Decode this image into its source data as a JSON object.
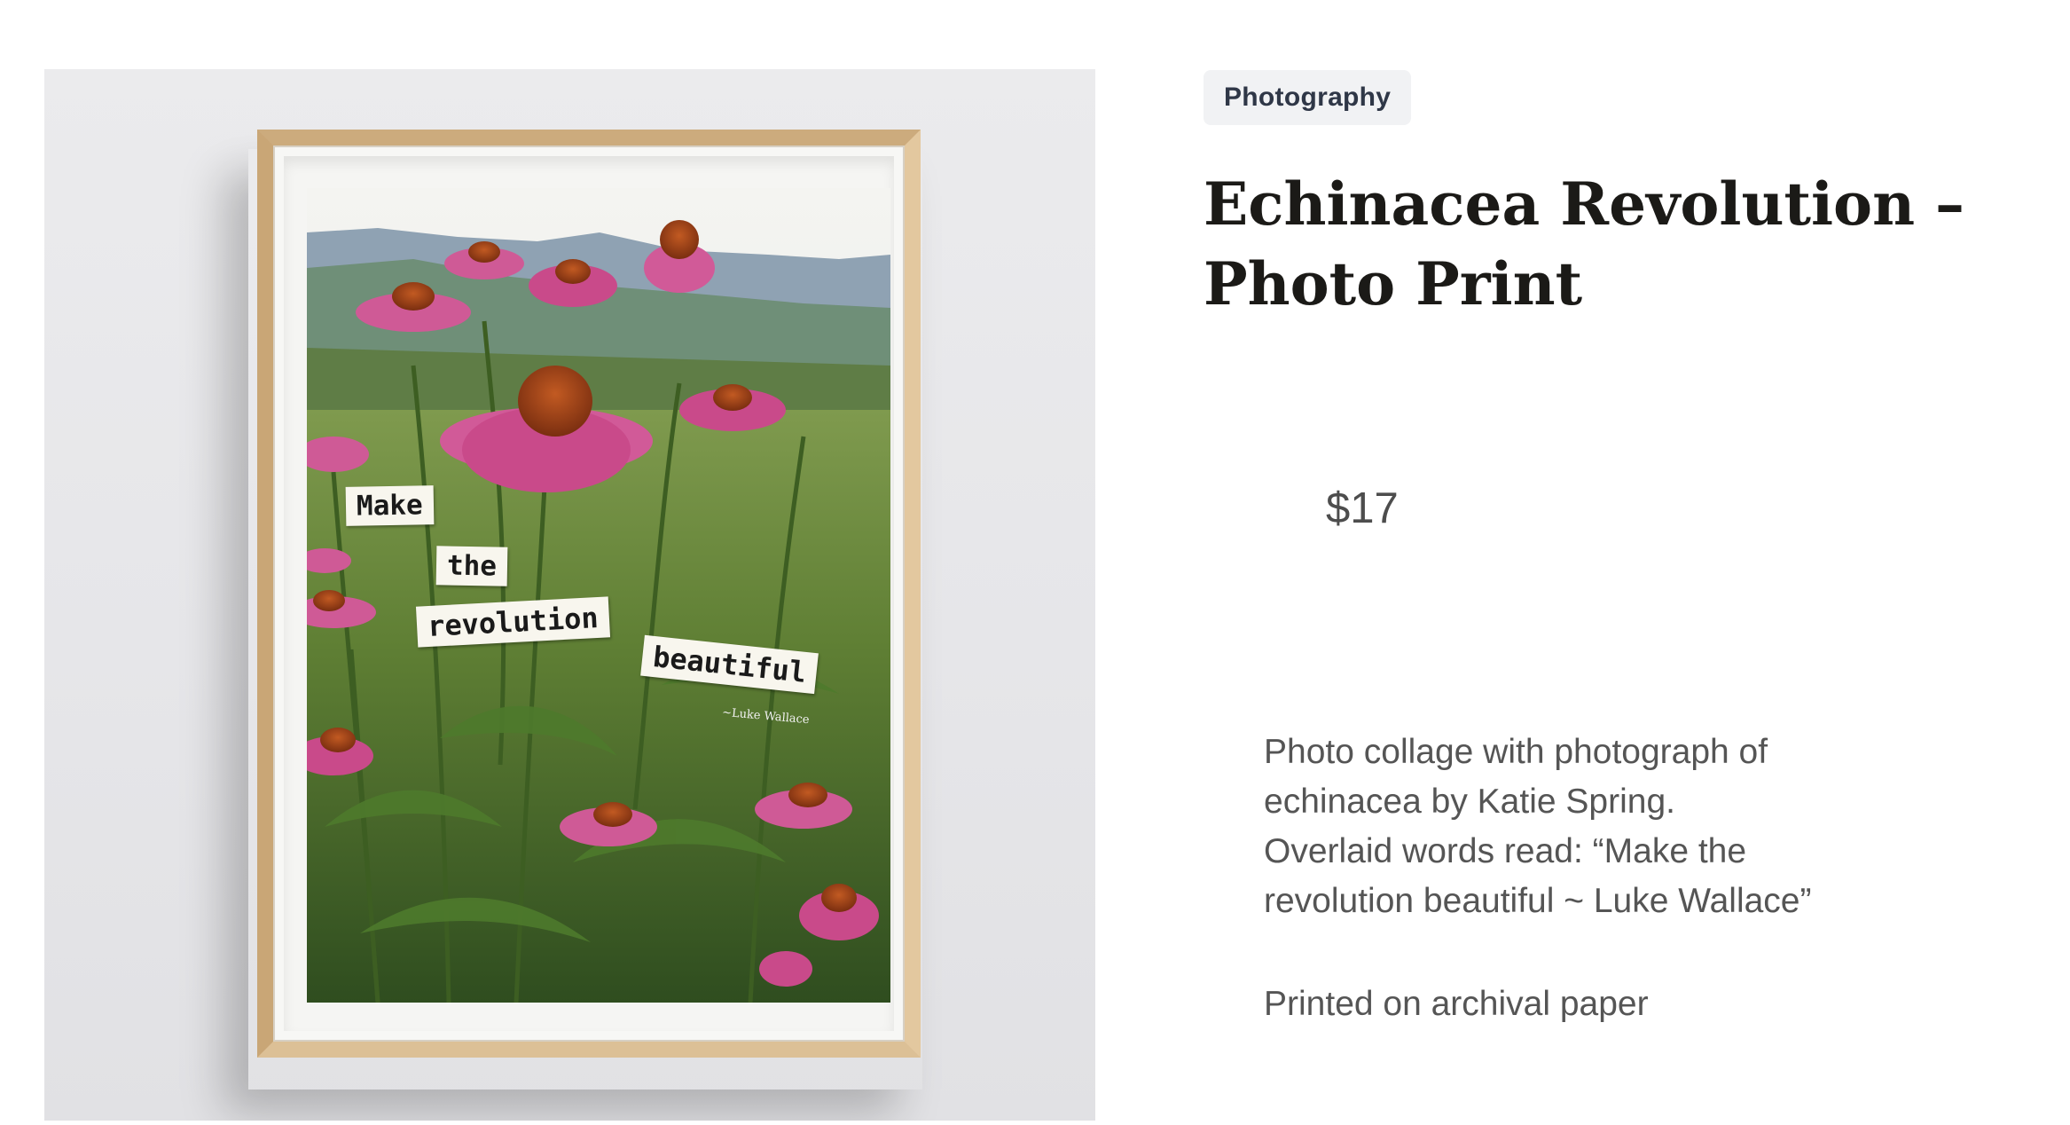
{
  "product": {
    "category_badge": "Photography",
    "title": "Echinacea Revolution – Photo Print",
    "price": "$17",
    "description": [
      "Photo collage with photograph of echinacea by Katie Spring. Overlaid words read: “Make the revolution beautiful ~ Luke Wallace”",
      "Printed on archival paper"
    ]
  },
  "artwork": {
    "words": [
      "Make",
      "the",
      "revolution",
      "beautiful"
    ],
    "attribution": "~Luke Wallace"
  },
  "colors": {
    "frame_wood": "#d9bb90",
    "petal_pink": "#c94a8a",
    "cone_orange": "#a8461c",
    "badge_bg": "#f1f2f4",
    "title_text": "#1b1a17"
  }
}
